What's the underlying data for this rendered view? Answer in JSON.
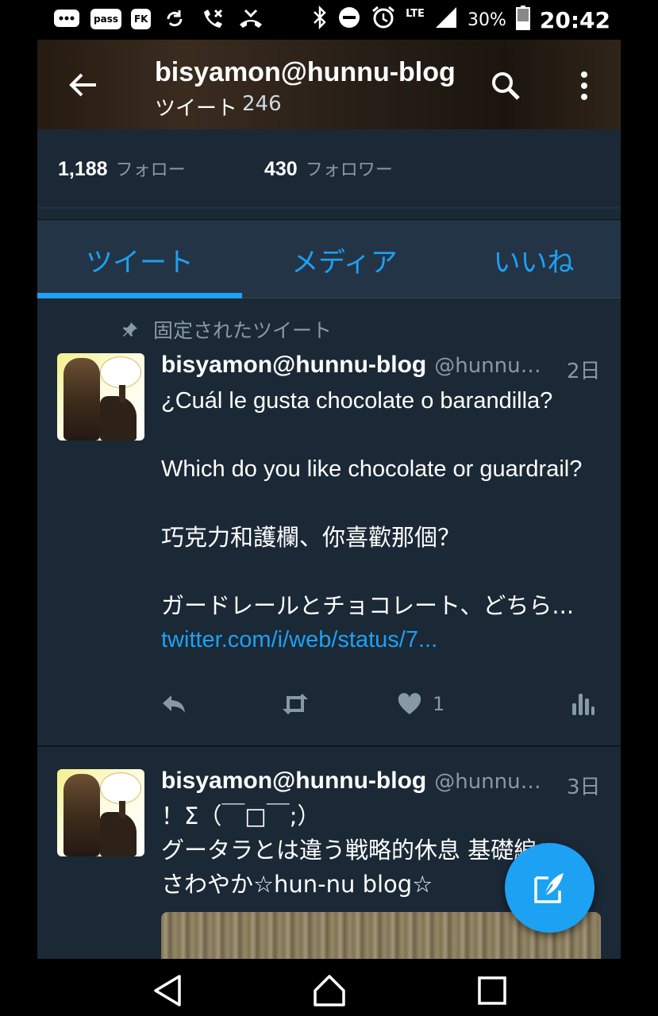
{
  "status_bar": {
    "icons_left": [
      "chat-bubble-icon",
      "pass-icon",
      "fk-icon",
      "sync-icon",
      "missed-call-icon",
      "call-forward-icon"
    ],
    "pass_label": "pass",
    "fk_label": "FK",
    "icons_right": [
      "bluetooth-icon",
      "do-not-disturb-icon",
      "alarm-icon",
      "signal-icon",
      "battery-icon"
    ],
    "network": "LTE",
    "battery": "30%",
    "time": "20:42"
  },
  "header": {
    "title": "bisyamon@hunnu-blog",
    "subtitle_label": "ツイート",
    "tweet_count": "246"
  },
  "profile": {
    "following_count": "1,188",
    "following_label": "フォロー",
    "followers_count": "430",
    "followers_label": "フォロワー"
  },
  "tabs": [
    {
      "label": "ツイート",
      "selected": true
    },
    {
      "label": "メディア",
      "selected": false
    },
    {
      "label": "いいね",
      "selected": false
    }
  ],
  "tweets": [
    {
      "pinned_label": "固定されたツイート",
      "name": "bisyamon@hunnu-blog",
      "handle": "@hunnum...",
      "time": "2日",
      "lines": [
        "¿Cuál le gusta chocolate o barandilla?",
        "Which do you like chocolate or guardrail?",
        "巧克力和護欄、你喜歡那個？",
        "ガードレールとチョコレート、どちら..."
      ],
      "link": "twitter.com/i/web/status/7...",
      "like_count": "1"
    },
    {
      "name": "bisyamon@hunnu-blog",
      "handle": "@hunnum...",
      "time": "3日",
      "lines": [
        "！Σ（￣□￣;）",
        "グータラとは違う戦略的休息 基礎編：",
        "さわやか☆hun-nu blog☆"
      ]
    }
  ],
  "colors": {
    "accent": "#1da1f2",
    "background": "#1b2836",
    "tab_background": "#243447",
    "secondary_text": "#8899a6"
  }
}
